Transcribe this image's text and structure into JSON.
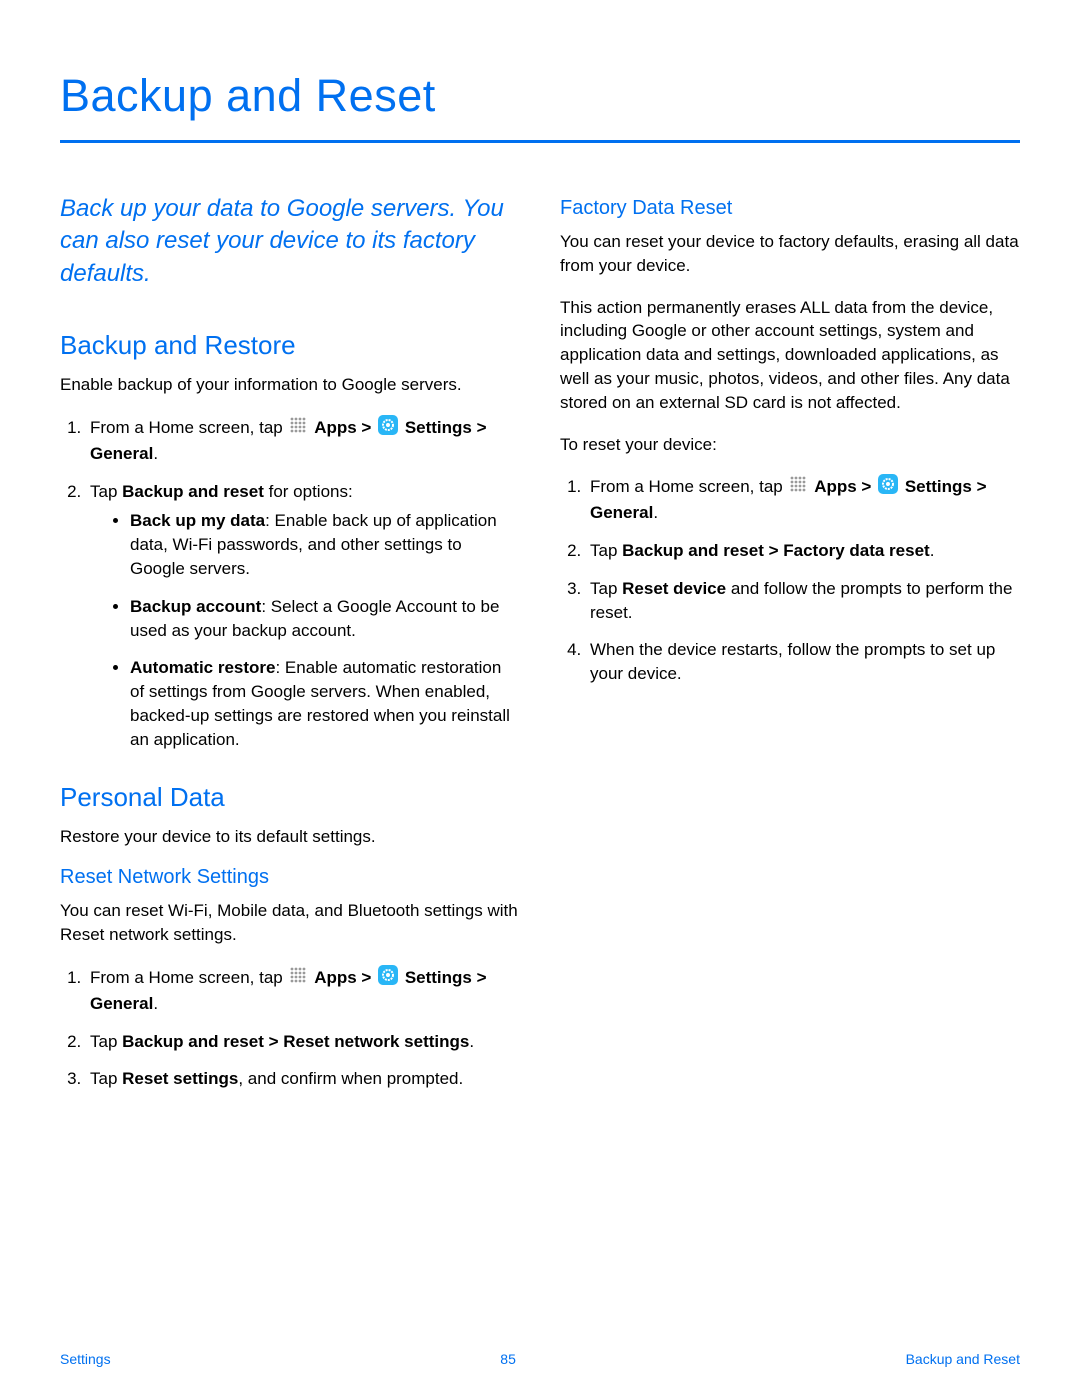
{
  "title": "Backup and Reset",
  "intro": "Back up your data to Google servers. You can also reset your device to its factory defaults.",
  "left": {
    "backup_restore": {
      "heading": "Backup and Restore",
      "desc": "Enable backup of your information to Google servers.",
      "step1_prefix": "From a Home screen, tap ",
      "apps_label": "Apps > ",
      "settings_label": "Settings > General",
      "step2_prefix": "Tap ",
      "step2_bold": "Backup and reset",
      "step2_suffix": " for options:",
      "bullets": [
        {
          "bold": "Back up my data",
          "rest": ": Enable back up of application data, Wi-Fi passwords, and other settings to Google servers."
        },
        {
          "bold": "Backup account",
          "rest": ": Select a Google Account to be used as your backup account."
        },
        {
          "bold": "Automatic restore",
          "rest": ": Enable automatic restoration of settings from Google servers. When enabled, backed-up settings are restored when you reinstall an application."
        }
      ]
    },
    "personal_data": {
      "heading": "Personal Data",
      "desc": "Restore your device to its default settings."
    },
    "reset_network": {
      "heading": "Reset Network Settings",
      "desc": "You can reset Wi-Fi, Mobile data, and Bluetooth settings with Reset network settings.",
      "step1_prefix": "From a Home screen, tap ",
      "apps_label": "Apps > ",
      "settings_label": "Settings > General",
      "step2_prefix": "Tap ",
      "step2_bold": "Backup and reset > Reset network settings",
      "step2_suffix": ".",
      "step3_prefix": "Tap ",
      "step3_bold": "Reset settings",
      "step3_suffix": ", and confirm when prompted."
    }
  },
  "right": {
    "factory_reset": {
      "heading": "Factory Data Reset",
      "p1": "You can reset your device to factory defaults, erasing all data from your device.",
      "p2": "This action permanently erases ALL data from the device, including Google or other account settings, system and application data and settings, downloaded applications, as well as your music, photos, videos, and other files. Any data stored on an external SD card is not affected.",
      "p3": "To reset your device:",
      "step1_prefix": "From a Home screen, tap ",
      "apps_label": "Apps > ",
      "settings_label": "Settings > General",
      "step2_prefix": "Tap ",
      "step2_bold": "Backup and reset > Factory data reset",
      "step2_suffix": ".",
      "step3_prefix": "Tap ",
      "step3_bold": "Reset device",
      "step3_suffix": " and follow the prompts to perform the reset.",
      "step4": "When the device restarts, follow the prompts to set up your device."
    }
  },
  "footer": {
    "left": "Settings",
    "center": "85",
    "right": "Backup and Reset"
  }
}
